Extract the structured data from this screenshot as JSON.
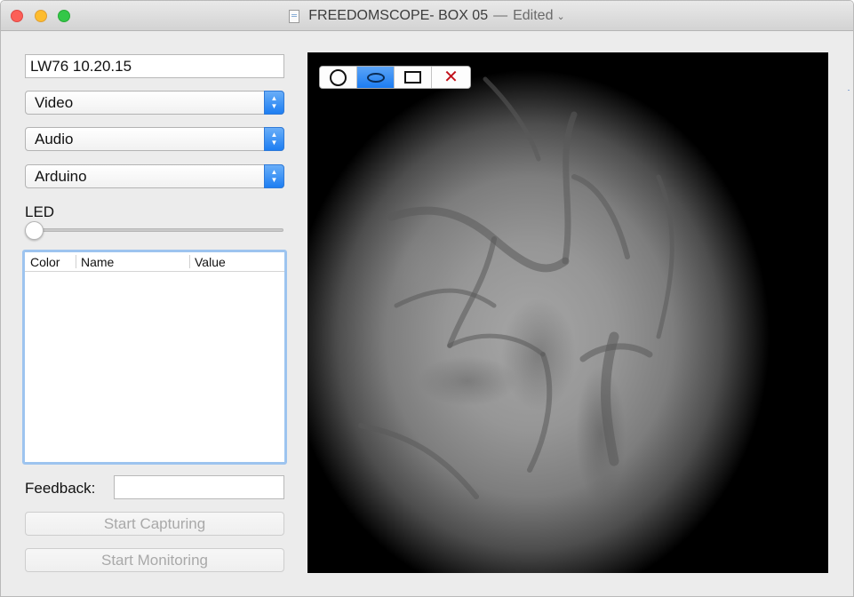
{
  "window": {
    "title": "FREEDOMSCOPE- BOX 05",
    "separator": "—",
    "status": "Edited",
    "status_chevron": "chevron-down-icon"
  },
  "form": {
    "session_name_value": "LW76 10.20.15",
    "video_select": "Video",
    "audio_select": "Audio",
    "arduino_select": "Arduino",
    "led_label": "LED",
    "led_level": 0
  },
  "table": {
    "columns": [
      "Color",
      "Name",
      "Value"
    ],
    "rows": []
  },
  "feedback": {
    "label": "Feedback:",
    "value": ""
  },
  "buttons": {
    "start_capturing": "Start Capturing",
    "start_monitoring": "Start Monitoring"
  },
  "roi_toolbar": {
    "tools": [
      {
        "name": "circle-tool",
        "icon": "circle-icon",
        "selected": false
      },
      {
        "name": "ellipse-tool",
        "icon": "ellipse-icon",
        "selected": true
      },
      {
        "name": "rectangle-tool",
        "icon": "rectangle-icon",
        "selected": false
      },
      {
        "name": "delete-tool",
        "icon": "close-icon",
        "selected": false
      }
    ],
    "delete_glyph": "✕"
  },
  "colors": {
    "accent": "#1d7ef2",
    "delete": "#c2111a",
    "disabled_text": "#a9a9a9"
  }
}
